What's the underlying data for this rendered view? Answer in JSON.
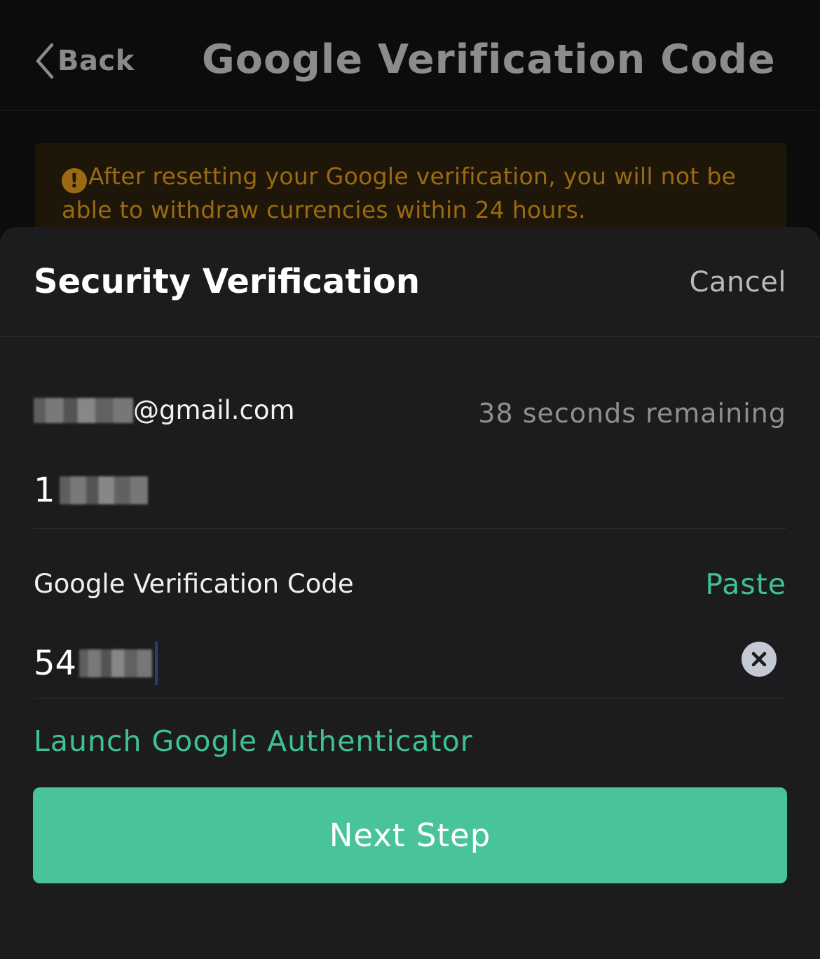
{
  "nav": {
    "back_label": "Back",
    "title": "Google Verification Code"
  },
  "warning": {
    "text": "After resetting your Google verification, you will not be able to withdraw currencies within 24 hours."
  },
  "sheet": {
    "title": "Security Verification",
    "cancel_label": "Cancel",
    "email_suffix": "@gmail.com",
    "countdown": "38 seconds remaining",
    "email_code_visible": "1",
    "google_label": "Google Verification Code",
    "paste_label": "Paste",
    "google_code_visible": "54",
    "launch_label": "Launch Google Authenticator",
    "next_label": "Next Step"
  },
  "colors": {
    "accent": "#49c49a",
    "link": "#3fc28f",
    "sheet_bg": "#1c1c1e",
    "warning_text": "#9a6a12"
  }
}
